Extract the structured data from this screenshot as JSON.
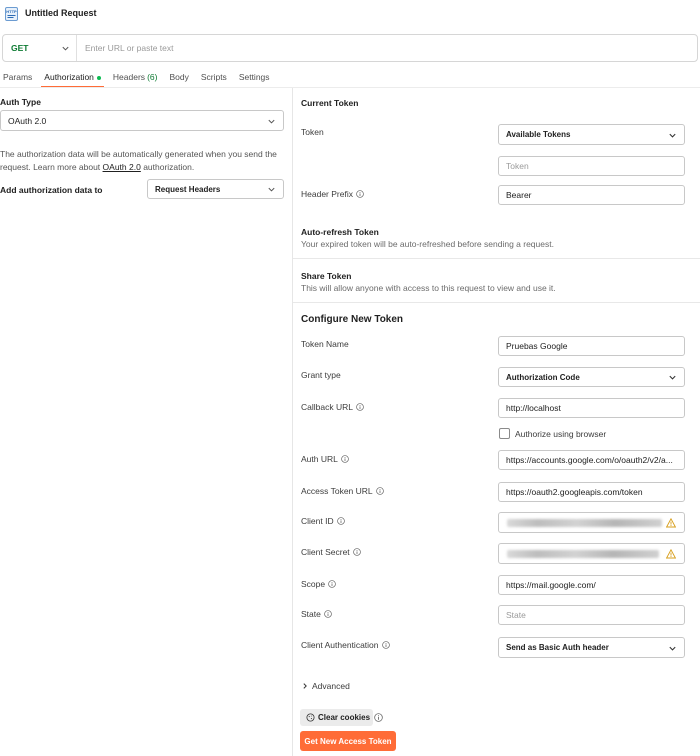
{
  "request": {
    "title": "Untitled Request",
    "icon": "http-request-icon"
  },
  "url_bar": {
    "method": "GET",
    "placeholder": "Enter URL or paste text",
    "value": ""
  },
  "tabs": [
    {
      "label": "Params"
    },
    {
      "label": "Authorization",
      "active": true,
      "status_dot_color": "#0cbb52"
    },
    {
      "label": "Headers",
      "count": "(6)"
    },
    {
      "label": "Body"
    },
    {
      "label": "Scripts"
    },
    {
      "label": "Settings"
    }
  ],
  "left_panel": {
    "auth_type_label": "Auth Type",
    "auth_type_value": "OAuth 2.0",
    "description_1": "The authorization data will be automatically generated when you send the request. Learn more about ",
    "description_link": "OAuth 2.0",
    "description_2": " authorization.",
    "add_to_label": "Add authorization data to",
    "add_to_value": "Request Headers"
  },
  "current_token": {
    "heading": "Current Token",
    "token_label": "Token",
    "token_select": "Available Tokens",
    "token_placeholder": "Token",
    "header_prefix_label": "Header Prefix",
    "header_prefix_value": "Bearer"
  },
  "auto_refresh": {
    "title": "Auto-refresh Token",
    "description": "Your expired token will be auto-refreshed before sending a request."
  },
  "share_token": {
    "title": "Share Token",
    "description": "This will allow anyone with access to this request to view and use it."
  },
  "configure": {
    "heading": "Configure New Token",
    "token_name_label": "Token Name",
    "token_name_value": "Pruebas Google",
    "grant_type_label": "Grant type",
    "grant_type_value": "Authorization Code",
    "callback_url_label": "Callback URL",
    "callback_url_value": "http://localhost",
    "authorize_browser_label": "Authorize using browser",
    "auth_url_label": "Auth URL",
    "auth_url_value": "https://accounts.google.com/o/oauth2/v2/a...",
    "access_token_url_label": "Access Token URL",
    "access_token_url_value": "https://oauth2.googleapis.com/token",
    "client_id_label": "Client ID",
    "client_secret_label": "Client Secret",
    "scope_label": "Scope",
    "scope_value": "https://mail.google.com/",
    "state_label": "State",
    "state_placeholder": "State",
    "client_auth_label": "Client Authentication",
    "client_auth_value": "Send as Basic Auth header",
    "advanced_label": "Advanced",
    "clear_cookies_label": "Clear cookies",
    "get_token_label": "Get New Access Token"
  },
  "colors": {
    "accent": "#ff6c37",
    "method_get": "#0d7a32",
    "warning": "#d79e1a"
  }
}
